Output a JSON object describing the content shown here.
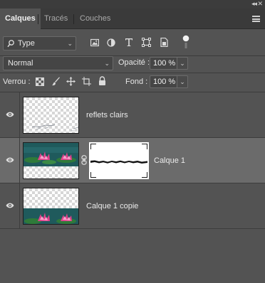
{
  "tabs": [
    {
      "label": "Calques",
      "active": true
    },
    {
      "label": "Tracés",
      "active": false
    },
    {
      "label": "Couches",
      "active": false
    }
  ],
  "filter": {
    "kind_label": "Type",
    "icons": [
      "image-filter-icon",
      "adjustment-filter-icon",
      "type-filter-icon",
      "shape-filter-icon",
      "smart-object-filter-icon",
      "filter-toggle-icon"
    ]
  },
  "blend": {
    "mode": "Normal",
    "opacity_label": "Opacité :",
    "opacity_value": "100 %"
  },
  "lock": {
    "label": "Verrou :",
    "icons": [
      "lock-transparent-pixels-icon",
      "lock-image-pixels-icon",
      "lock-position-icon",
      "lock-artboard-icon",
      "lock-all-icon"
    ],
    "fill_label": "Fond :",
    "fill_value": "100 %"
  },
  "layers": [
    {
      "name": "reflets clairs",
      "visible": true,
      "selected": false,
      "has_mask": false
    },
    {
      "name": "Calque 1",
      "visible": true,
      "selected": true,
      "has_mask": true
    },
    {
      "name": "Calque 1 copie",
      "visible": true,
      "selected": false,
      "has_mask": false
    }
  ],
  "colors": {
    "panel_bg": "#535353",
    "selected_layer_bg": "#6b6b6b",
    "tab_bar_bg": "#3a3a3a"
  }
}
